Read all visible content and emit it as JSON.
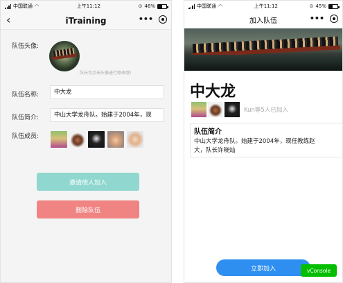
{
  "status_left": {
    "carrier": "中国联通",
    "time": "上午11:12",
    "battery": "46%",
    "battery_level": 0.46
  },
  "status_right": {
    "carrier": "中国联通",
    "time": "上午11:12",
    "battery": "45%",
    "battery_level": 0.45
  },
  "left_page": {
    "nav_title": "iTraining",
    "form": {
      "avatar_label": "队伍头像:",
      "avatar_hint": "队长可点击头像进行修改哦!",
      "name_label": "队伍名称:",
      "name_value": "中大龙",
      "intro_label": "队伍简介:",
      "intro_value": "中山大学龙舟队。始建于2004年，现",
      "members_label": "队伍成员:"
    },
    "buttons": {
      "invite": "邀请他人加入",
      "delete": "删除队伍"
    }
  },
  "right_page": {
    "nav_title": "加入队伍",
    "team_name": "中大龙",
    "joined_text": "Kun等5人已加入",
    "intro_title": "队伍简介",
    "intro_text": "中山大学龙舟队。始建于2004年，现任教练赵",
    "intro_text_line2": "大，队长许晓灿",
    "join_button": "立即加入",
    "vconsole": "vConsole"
  },
  "colors": {
    "invite_button": "#8fd7cf",
    "delete_button": "#f08483",
    "join_button": "#2e8ff0",
    "vconsole": "#04be02"
  }
}
